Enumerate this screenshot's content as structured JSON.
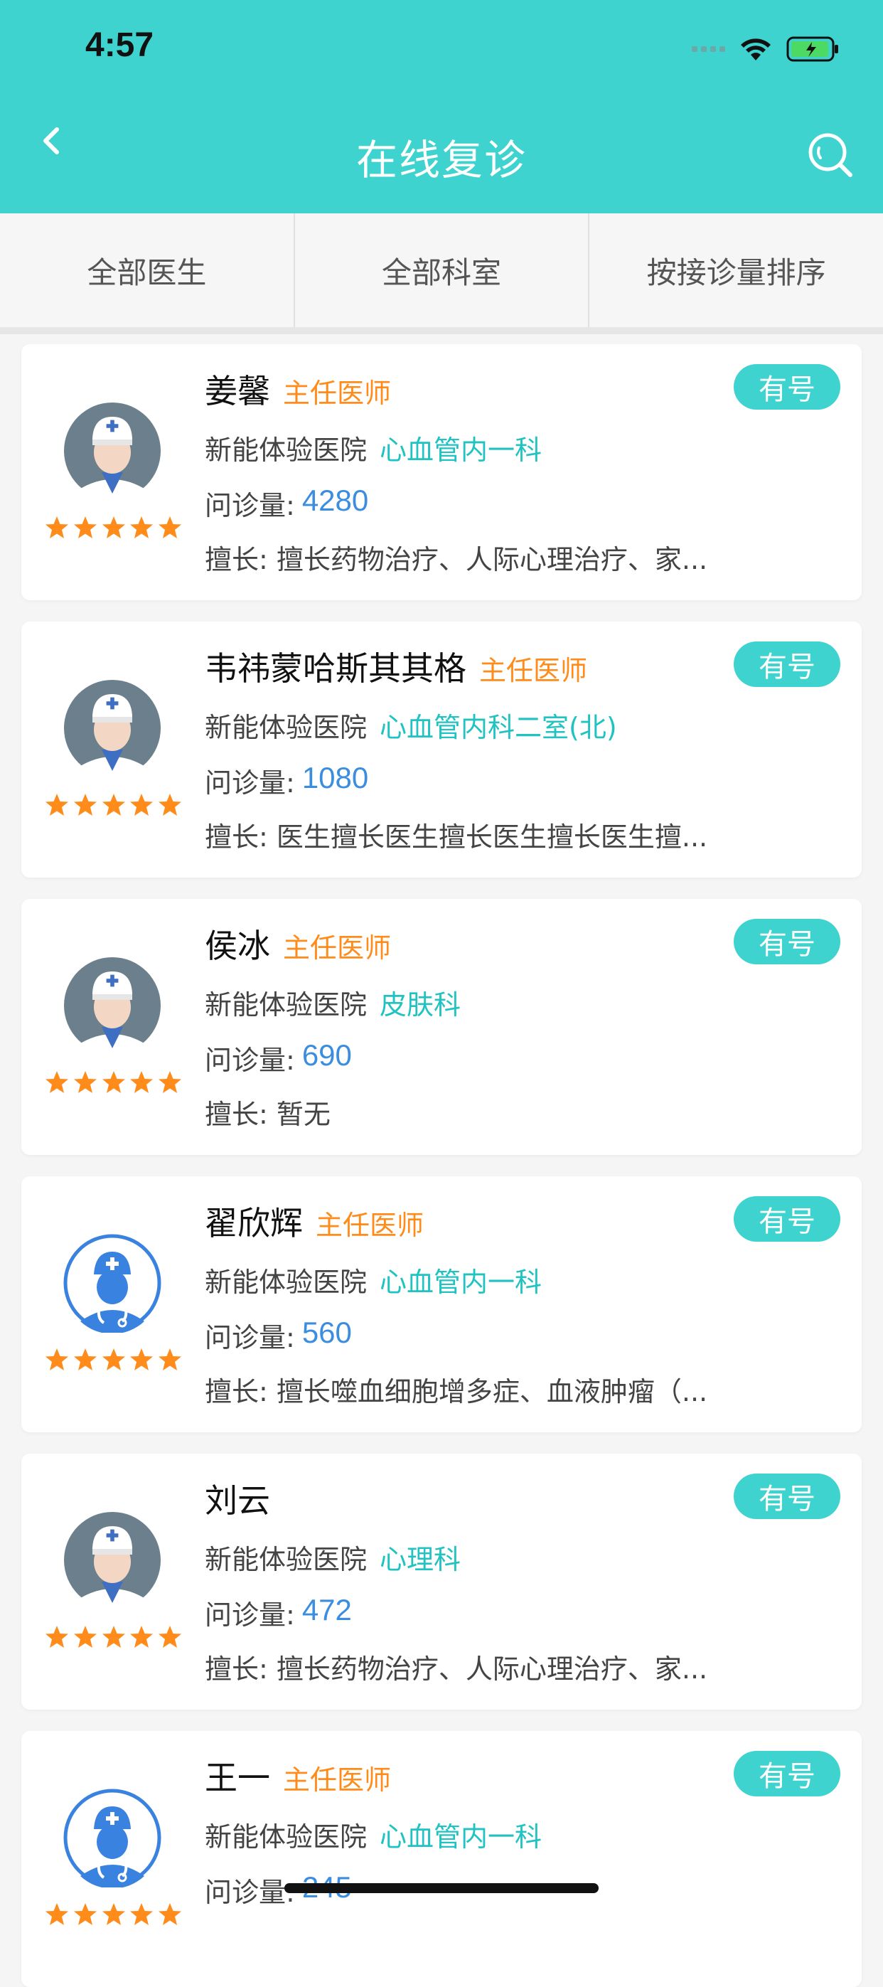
{
  "status_bar": {
    "time": "4:57"
  },
  "header": {
    "title": "在线复诊"
  },
  "tabs": [
    {
      "label": "全部医生"
    },
    {
      "label": "全部科室"
    },
    {
      "label": "按接诊量排序"
    }
  ],
  "common": {
    "count_prefix": "问诊量:",
    "badge": "有号",
    "stars": 5
  },
  "doctors": [
    {
      "name": "姜馨",
      "rank": "主任医师",
      "hospital": "新能体验医院",
      "dept": "心血管内一科",
      "count": "4280",
      "skill": "擅长: 擅长药物治疗、人际心理治疗、家...",
      "avatar": "grey"
    },
    {
      "name": "韦祎蒙哈斯其其格",
      "rank": "主任医师",
      "hospital": "新能体验医院",
      "dept": "心血管内科二室(北)",
      "count": "1080",
      "skill": "擅长: 医生擅长医生擅长医生擅长医生擅...",
      "avatar": "grey"
    },
    {
      "name": "侯冰",
      "rank": "主任医师",
      "hospital": "新能体验医院",
      "dept": "皮肤科",
      "count": "690",
      "skill": "擅长: 暂无",
      "avatar": "grey"
    },
    {
      "name": "翟欣辉",
      "rank": "主任医师",
      "hospital": "新能体验医院",
      "dept": "心血管内一科",
      "count": "560",
      "skill": "擅长: 擅长噬血细胞增多症、血液肿瘤（...",
      "avatar": "blue"
    },
    {
      "name": "刘云",
      "rank": "",
      "hospital": "新能体验医院",
      "dept": "心理科",
      "count": "472",
      "skill": "擅长: 擅长药物治疗、人际心理治疗、家...",
      "avatar": "grey"
    },
    {
      "name": "王一",
      "rank": "主任医师",
      "hospital": "新能体验医院",
      "dept": "心血管内一科",
      "count": "245",
      "skill": "",
      "avatar": "blue"
    }
  ]
}
